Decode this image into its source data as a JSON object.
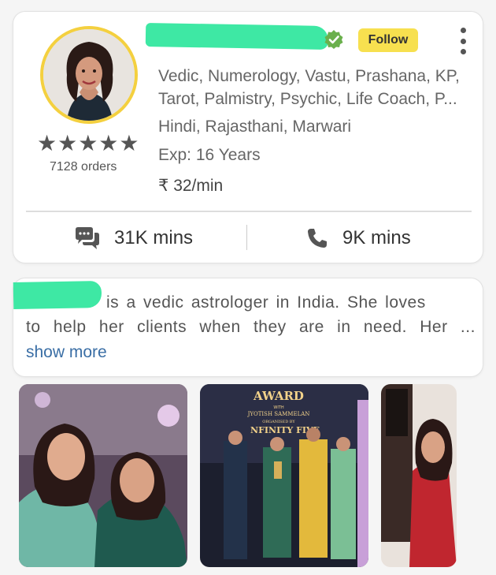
{
  "profile": {
    "follow_label": "Follow",
    "skills_line1": "Vedic, Numerology, Vastu, Prashana, KP,",
    "skills_line2": "Tarot, Palmistry, Psychic, Life Coach, P...",
    "languages": "Hindi, Rajasthani, Marwari",
    "experience": "Exp: 16 Years",
    "price": "₹ 32/min",
    "rating_stars": "★★★★★",
    "orders": "7128 orders",
    "chat_mins": "31K mins",
    "call_mins": "9K mins"
  },
  "about": {
    "line1": "is a vedic astrologer in India. She loves",
    "line2": "to help her clients when they are in need. Her ...",
    "show_more": "show more"
  },
  "gallery": {
    "award_title": "AWARD",
    "award_with": "WITH",
    "award_org": "JYOTISH SAMMELAN",
    "award_by": "ORGANISED BY",
    "award_brand": "NFINITY FIVE"
  },
  "colors": {
    "follow_bg": "#f7e04f",
    "avatar_ring": "#f4d03f",
    "verified": "#6ab04c",
    "link": "#3a6ea5",
    "redaction": "#3ee8a4"
  },
  "icons": [
    "verified-badge-icon",
    "more-vert-icon",
    "chat-bubble-icon",
    "phone-icon",
    "star-icon"
  ]
}
